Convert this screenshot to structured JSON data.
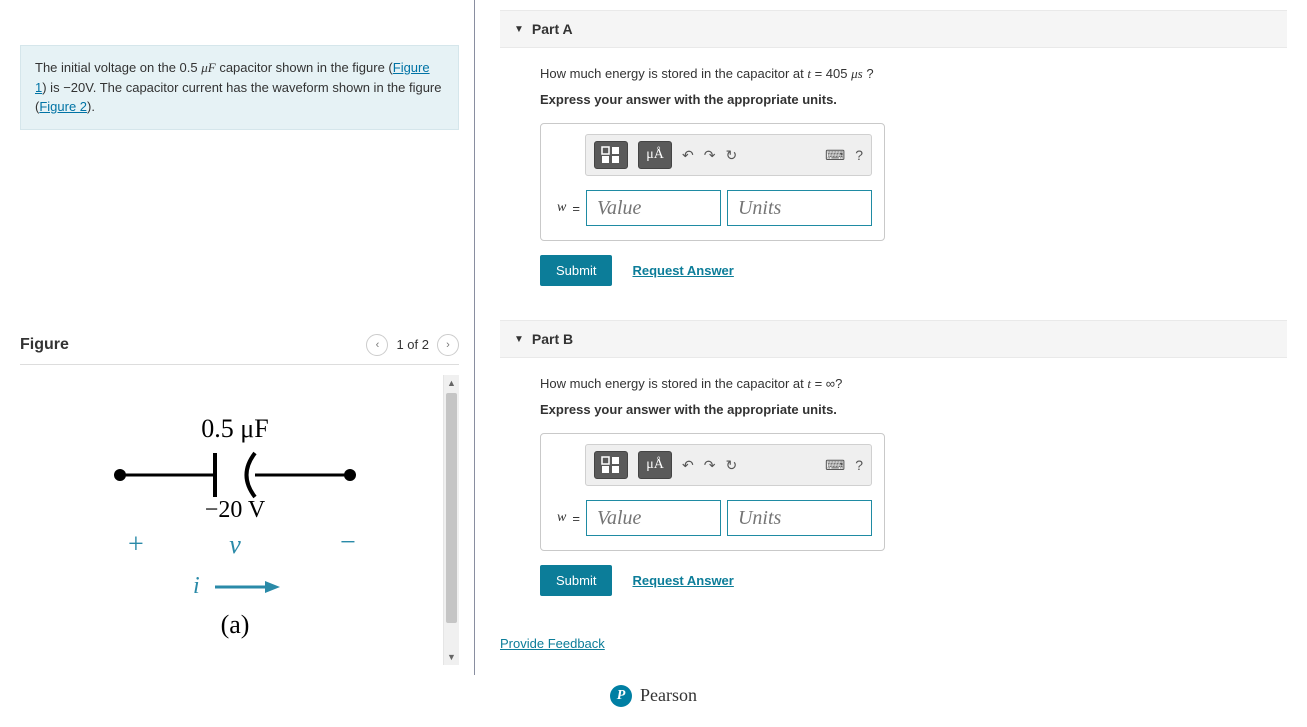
{
  "problem": {
    "text_before_link1": "The initial voltage on the 0.5 ",
    "muF": "μF",
    "text_after_muF": " capacitor shown in the figure (",
    "figure1_link": "Figure 1",
    "text_mid": ") is ",
    "voltage": "−20V",
    "text_after_v": ". The capacitor current has the waveform shown in the figure (",
    "figure2_link": "Figure 2",
    "text_end": ")."
  },
  "figure": {
    "title": "Figure",
    "pager_label": "1 of 2",
    "capacitance_label": "0.5 μF",
    "voltage_label": "−20 V",
    "plus": "+",
    "minus": "−",
    "v_var": "v",
    "i_var": "i",
    "sub_label": "(a)"
  },
  "parts": [
    {
      "title": "Part A",
      "question_pre": "How much energy is stored in the capacitor at ",
      "question_t": "t",
      "question_eq": " = 405 ",
      "question_unit": "μs",
      "question_post": " ?",
      "instruction": "Express your answer with the appropriate units.",
      "var": "w",
      "value_placeholder": "Value",
      "units_placeholder": "Units",
      "submit": "Submit",
      "request": "Request Answer"
    },
    {
      "title": "Part B",
      "question_pre": "How much energy is stored in the capacitor at ",
      "question_t": "t",
      "question_eq": " = ∞",
      "question_unit": "",
      "question_post": "?",
      "instruction": "Express your answer with the appropriate units.",
      "var": "w",
      "value_placeholder": "Value",
      "units_placeholder": "Units",
      "submit": "Submit",
      "request": "Request Answer"
    }
  ],
  "toolbar": {
    "template_btn": "▢",
    "units_btn": "μÅ",
    "undo": "↶",
    "redo": "↷",
    "reset": "↻",
    "keyboard": "⌨",
    "help": "?"
  },
  "feedback": "Provide Feedback",
  "footer": {
    "brand": "Pearson",
    "logo_letter": "P"
  }
}
